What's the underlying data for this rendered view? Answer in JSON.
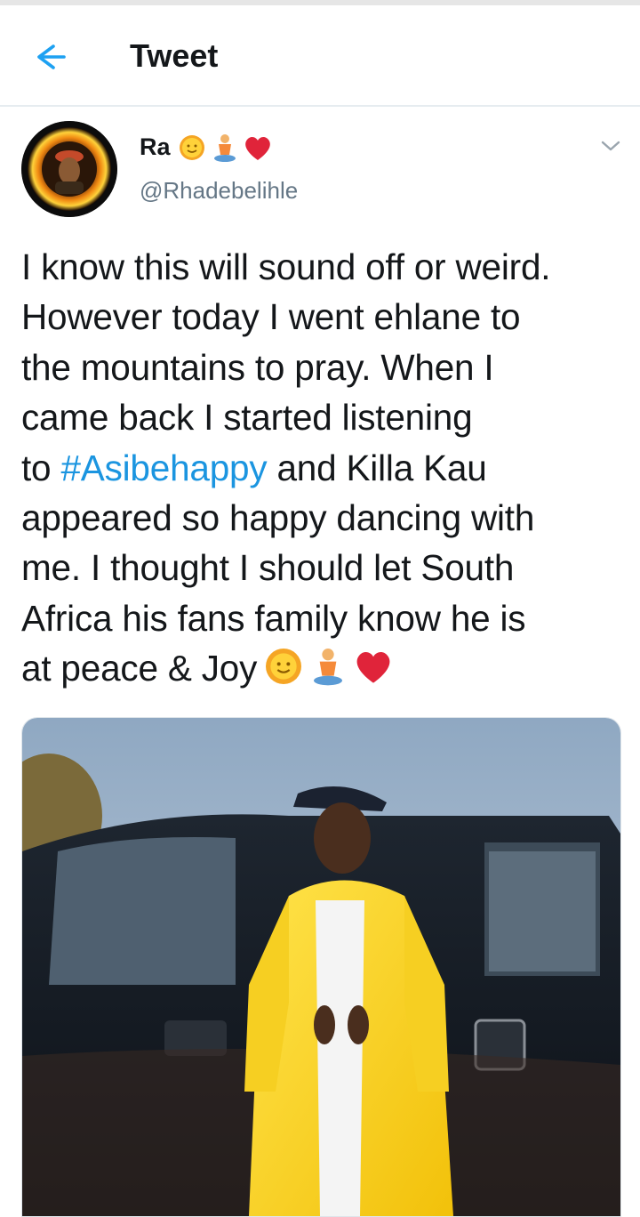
{
  "header": {
    "title": "Tweet"
  },
  "tweet": {
    "name": "Ra",
    "handle": "@Rhadebelihle",
    "name_emojis": [
      "sun-icon",
      "person-in-lotus-position-icon",
      "red-heart-icon"
    ],
    "text_lines": [
      "I know this will sound off or weird.",
      "However today I went ehlane to",
      "the mountains to pray. When I",
      "came back I started listening"
    ],
    "line5_pre": "to ",
    "hashtag": "#Asibehappy",
    "line5_post": " and Killa Kau",
    "text_lines_2": [
      "appeared so happy dancing with",
      "me. I thought I should let South",
      "Africa his fans family know he is"
    ],
    "last_line": "at peace & Joy",
    "colors": {
      "link": "#1b95e0",
      "text": "#14171a",
      "secondary": "#657786",
      "heart": "#e0243a"
    }
  }
}
